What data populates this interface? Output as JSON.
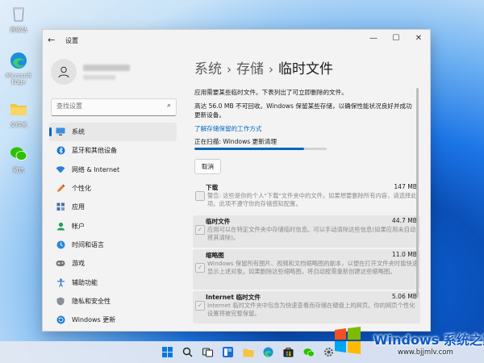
{
  "desktop": {
    "icons": [
      {
        "label": "回收站",
        "icon": "recycle-bin-icon"
      },
      {
        "label": "Microsoft Edge",
        "icon": "edge-icon"
      },
      {
        "label": "文件夹",
        "icon": "folder-icon"
      },
      {
        "label": "微信",
        "icon": "wechat-icon"
      }
    ]
  },
  "window": {
    "app_title": "设置",
    "controls": {
      "minimize": "—",
      "maximize": "☐",
      "close": "✕"
    }
  },
  "sidebar": {
    "search_placeholder": "查找设置",
    "items": [
      {
        "label": "系统",
        "icon": "monitor-icon",
        "active": true
      },
      {
        "label": "蓝牙和其他设备",
        "icon": "bluetooth-icon"
      },
      {
        "label": "网络 & Internet",
        "icon": "wifi-icon"
      },
      {
        "label": "个性化",
        "icon": "brush-icon"
      },
      {
        "label": "应用",
        "icon": "apps-icon"
      },
      {
        "label": "帐户",
        "icon": "account-icon"
      },
      {
        "label": "时间和语言",
        "icon": "globe-clock-icon"
      },
      {
        "label": "游戏",
        "icon": "gamepad-icon"
      },
      {
        "label": "辅助功能",
        "icon": "accessibility-icon"
      },
      {
        "label": "隐私和安全性",
        "icon": "shield-icon"
      },
      {
        "label": "Windows 更新",
        "icon": "update-icon"
      }
    ]
  },
  "breadcrumb": {
    "items": [
      "系统",
      "存储",
      "临时文件"
    ],
    "separator": "›"
  },
  "main": {
    "intro": "应用需要某些临时文件。下表列出了可立即删除的文件。",
    "info": "高达 56.0 MB 不可回收。Windows 保留某些存储，以确保性能状况良好并成功更新设备。",
    "learn_link": "了解存储保留的工作方式",
    "scanning_text": "正在扫描: Windows 更新清理",
    "progress": 0.83,
    "cancel_label": "取消",
    "items": [
      {
        "title": "下载",
        "size": "147 MB",
        "desc": "警告: 这些是你的个人\"下载\"文件夹中的文件。如果想要删除所有内容，请选择此项。此项不遵守你的存储感知配置。"
      },
      {
        "title": "临时文件",
        "size": "44.7 MB",
        "desc": "应用可以在特定文件夹中存储临时信息。可以手动清除这些信息(如果应用未自动将其清除)。"
      },
      {
        "title": "缩略图",
        "size": "11.0 MB",
        "desc": "Windows 保留所有图片、视频和文档缩略图的副本，以便在打开文件夹时能快速显示上述对象。如果删除这些缩略图，将自动按需重新创建这些缩略图。"
      },
      {
        "title": "Internet 临时文件",
        "size": "5.06 MB",
        "desc": "Internet 临时文件夹中包含为快速查看而存储在硬盘上的网页。你的网页个性化设置将被完整保留。"
      }
    ]
  },
  "taskbar": {
    "icons": [
      "windows-start-icon",
      "search-icon",
      "task-view-icon",
      "widgets-icon",
      "file-explorer-icon",
      "edge-icon",
      "store-icon",
      "wechat-icon",
      "settings-icon"
    ]
  },
  "watermark": {
    "title": "Windows 系统之家",
    "url": "www.bjjmlv.com"
  },
  "colors": {
    "accent": "#0067c0",
    "watermark": "#0b57c5"
  }
}
